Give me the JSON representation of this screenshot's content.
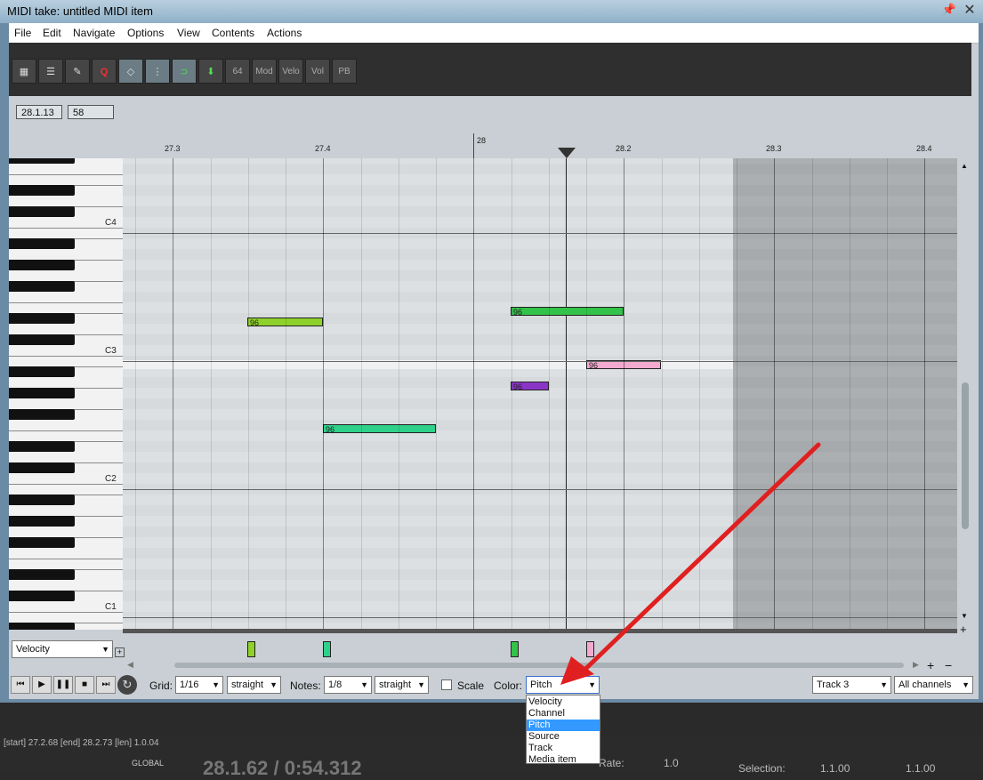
{
  "window": {
    "title": "MIDI take: untitled MIDI item",
    "pin_icon": "pin-icon",
    "close_glyph": "✕"
  },
  "menu": [
    "File",
    "Edit",
    "Navigate",
    "Options",
    "View",
    "Contents",
    "Actions"
  ],
  "toolbar": {
    "text_buttons": [
      "64",
      "Mod",
      "Velo",
      "Vol",
      "PB"
    ]
  },
  "info": {
    "position": "28.1.13",
    "value": "58"
  },
  "ruler": {
    "labels": [
      "27.3",
      "27.4",
      "28",
      "28.2",
      "28.3",
      "28.4"
    ]
  },
  "keyboard": {
    "octaves": [
      "C4",
      "C3",
      "C2",
      "C1"
    ]
  },
  "notes": [
    {
      "label": "96",
      "color": "#8ed12a"
    },
    {
      "label": "96",
      "color": "#33c24a"
    },
    {
      "label": "96",
      "color": "#f4a9cf"
    },
    {
      "label": "96",
      "color": "#8a35c7"
    },
    {
      "label": "96",
      "color": "#2fd08a"
    }
  ],
  "cc": {
    "lane_select": "Velocity",
    "bars": [
      {
        "color": "#8ed12a"
      },
      {
        "color": "#2fd08a"
      },
      {
        "color": "#33c24a"
      },
      {
        "color": "#f4a9cf"
      }
    ]
  },
  "bottom": {
    "grid_label": "Grid:",
    "grid_value": "1/16",
    "grid_type": "straight",
    "notes_label": "Notes:",
    "notes_value": "1/8",
    "notes_type": "straight",
    "scale_label": "Scale",
    "color_label": "Color:",
    "color_value": "Pitch",
    "track_value": "Track 3",
    "channel_value": "All channels"
  },
  "color_menu": {
    "options": [
      "Velocity",
      "Channel",
      "Pitch",
      "Source",
      "Track",
      "Media item"
    ],
    "selected": "Pitch"
  },
  "statusbar": {
    "selection_text": "[start] 27.2.68 [end] 28.2.73 [len] 1.0.04",
    "global_label": "GLOBAL",
    "time_display": "28.1.62 / 0:54.312",
    "rate_label": "Rate:",
    "rate_value": "1.0",
    "selection_label": "Selection:",
    "sel_start": "1.1.00",
    "sel_end": "1.1.00"
  },
  "colors": {
    "annotation_arrow": "#e02020"
  }
}
